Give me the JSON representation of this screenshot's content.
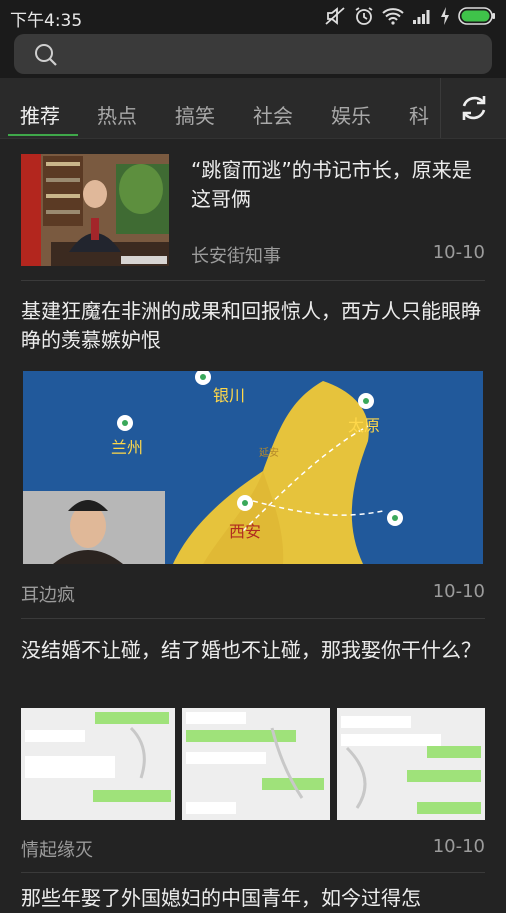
{
  "status_bar": {
    "time": "下午4:35",
    "icons": [
      "mute-icon",
      "alarm-icon",
      "wifi-icon",
      "signal-icon",
      "charging-icon",
      "battery-icon"
    ]
  },
  "search": {
    "icon": "search-icon",
    "placeholder": ""
  },
  "tabs": [
    {
      "label": "推荐",
      "active": true
    },
    {
      "label": "热点",
      "active": false
    },
    {
      "label": "搞笑",
      "active": false
    },
    {
      "label": "社会",
      "active": false
    },
    {
      "label": "娱乐",
      "active": false
    },
    {
      "label": "科",
      "active": false
    }
  ],
  "refresh_icon": "refresh-icon",
  "colors": {
    "accent": "#3fa84a",
    "background": "#232323"
  },
  "feed": [
    {
      "title": "“跳窗而逃”的书记市长，原来是这哥俩",
      "source": "长安街知事",
      "date": "10-10",
      "image": "official-at-desk-thumbnail"
    },
    {
      "title": "基建狂魔在非洲的成果和回报惊人，西方人只能眼睁睁的羡慕嫉妒恨",
      "source": "耳边疯",
      "date": "10-10",
      "image": "china-map-video-thumbnail",
      "map_labels": [
        "银川",
        "兰州",
        "太原",
        "西安",
        "延安"
      ]
    },
    {
      "title": "没结婚不让碰，结了婚也不让碰，那我娶你干什么？",
      "source": "情起缘灭",
      "date": "10-10",
      "images": [
        "chat-screenshot-1",
        "chat-screenshot-2",
        "chat-screenshot-3"
      ]
    },
    {
      "title": "那些年娶了外国媳妇的中国青年，如今过得怎",
      "source": "",
      "date": ""
    }
  ]
}
